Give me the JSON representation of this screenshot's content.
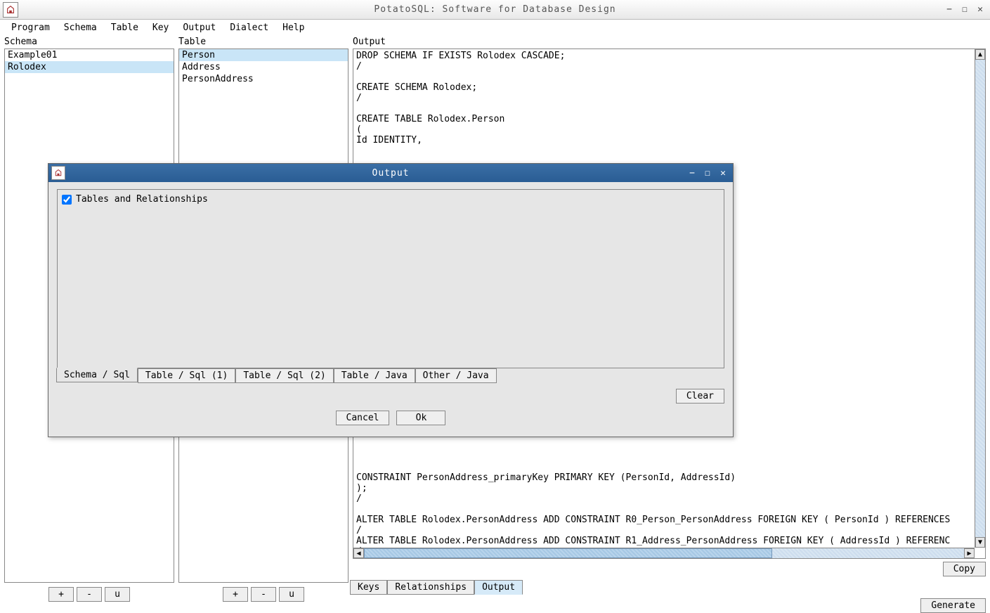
{
  "window": {
    "title": "PotatoSQL: Software for Database Design"
  },
  "menu": {
    "items": [
      "Program",
      "Schema",
      "Table",
      "Key",
      "Output",
      "Dialect",
      "Help"
    ]
  },
  "panels": {
    "schema": {
      "label": "Schema",
      "items": [
        "Example01",
        "Rolodex"
      ],
      "selected_index": 1,
      "buttons": {
        "add": "+",
        "remove": "-",
        "update": "u"
      }
    },
    "table": {
      "label": "Table",
      "items": [
        "Person",
        "Address",
        "PersonAddress"
      ],
      "selected_index": 0,
      "buttons": {
        "add": "+",
        "remove": "-",
        "update": "u"
      }
    },
    "output": {
      "label": "Output",
      "text": "DROP SCHEMA IF EXISTS Rolodex CASCADE;\n/\n\nCREATE SCHEMA Rolodex;\n/\n\nCREATE TABLE Rolodex.Person\n(\nId IDENTITY,\n\n\n\n\n\n\n\n\n\n\n\n\n\n\n\n\n\n\n\n\n\n\n\n\n\n\n\n\n\n\n\nCONSTRAINT PersonAddress_primaryKey PRIMARY KEY (PersonId, AddressId)\n);\n/\n\nALTER TABLE Rolodex.PersonAddress ADD CONSTRAINT R0_Person_PersonAddress FOREIGN KEY ( PersonId ) REFERENCES\n/\nALTER TABLE Rolodex.PersonAddress ADD CONSTRAINT R1_Address_PersonAddress FOREIGN KEY ( AddressId ) REFERENC\n/",
      "copy_label": "Copy"
    },
    "bottom_tabs": {
      "items": [
        "Keys",
        "Relationships",
        "Output"
      ],
      "active_index": 2
    },
    "generate_label": "Generate"
  },
  "dialog": {
    "title": "Output",
    "checkbox_label": "Tables and Relationships",
    "checkbox_checked": true,
    "tabs": {
      "items": [
        "Schema / Sql",
        "Table / Sql (1)",
        "Table / Sql (2)",
        "Table / Java",
        "Other / Java"
      ],
      "active_index": 0
    },
    "clear_label": "Clear",
    "cancel_label": "Cancel",
    "ok_label": "Ok"
  }
}
